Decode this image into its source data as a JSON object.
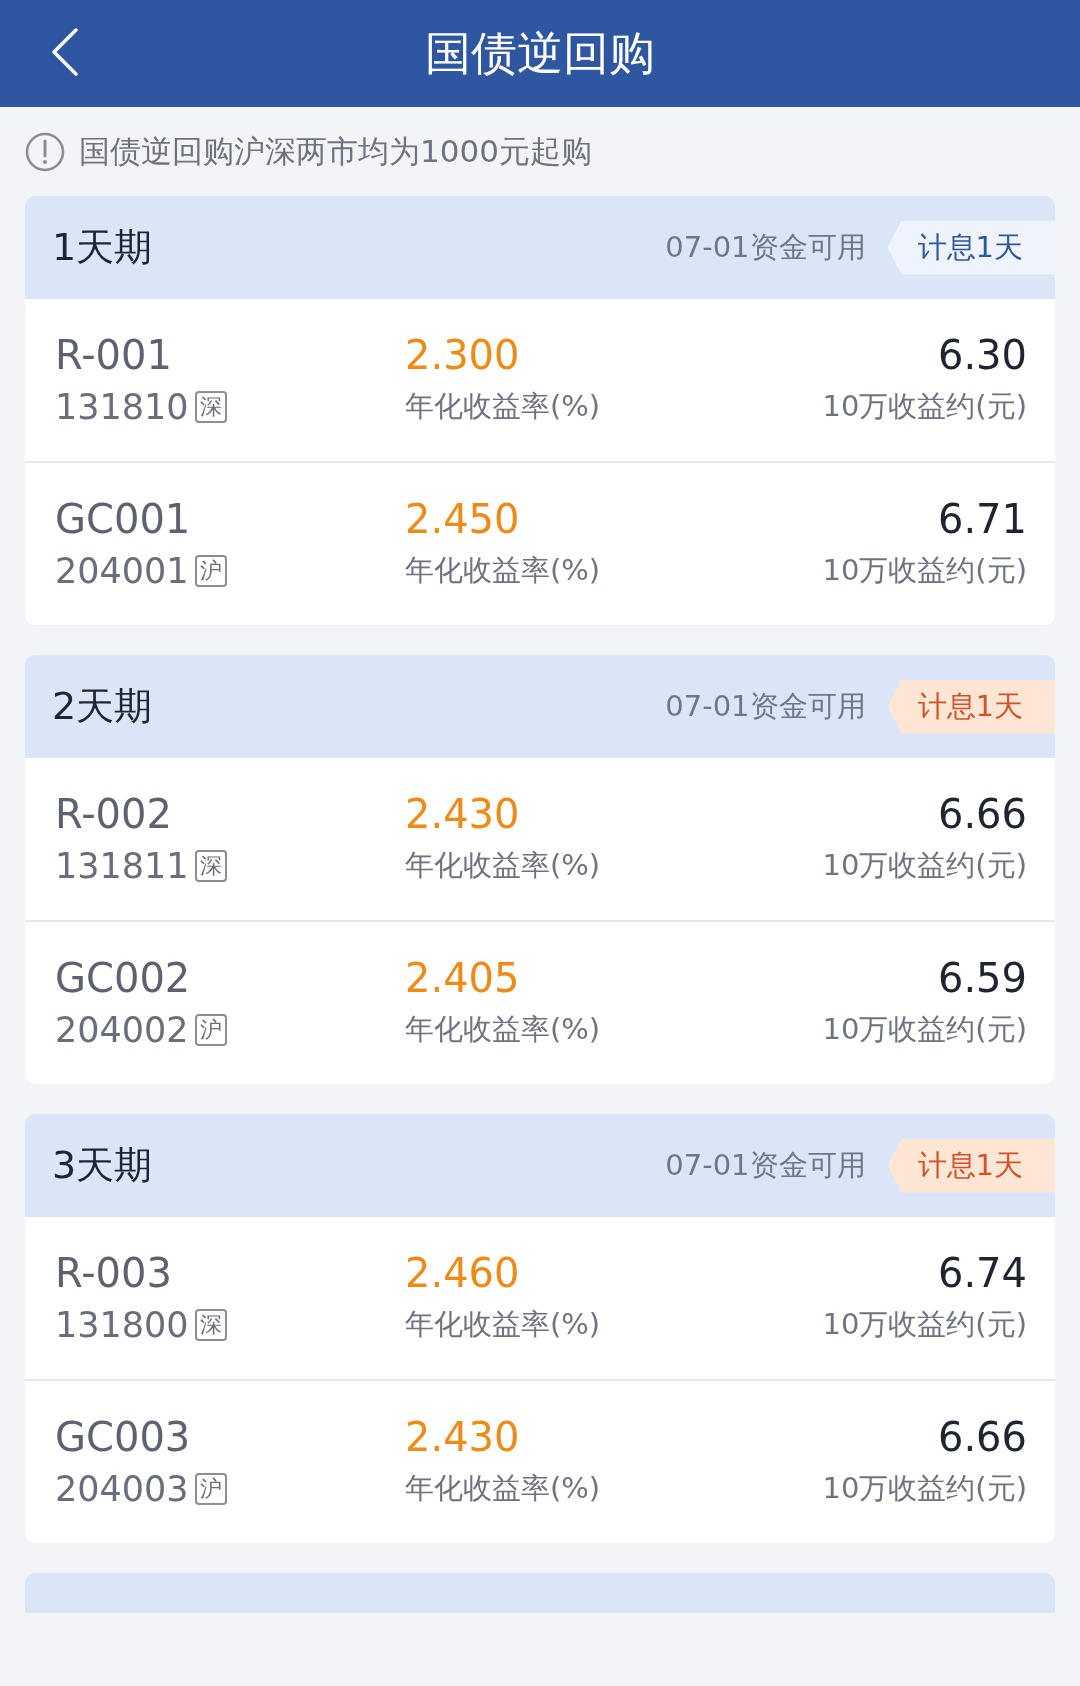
{
  "header": {
    "title": "国债逆回购"
  },
  "notice": "国债逆回购沪深两市均为1000元起购",
  "sections": [
    {
      "title": "1天期",
      "available": "07-01资金可用",
      "tag": {
        "label": "计息1天",
        "highlighted": false
      },
      "items": [
        {
          "name": "R-001",
          "code": "131810",
          "market": "深",
          "rate": "2.300",
          "rate_label": "年化收益率(%)",
          "earning": "6.30",
          "earning_label": "10万收益约(元)"
        },
        {
          "name": "GC001",
          "code": "204001",
          "market": "沪",
          "rate": "2.450",
          "rate_label": "年化收益率(%)",
          "earning": "6.71",
          "earning_label": "10万收益约(元)"
        }
      ]
    },
    {
      "title": "2天期",
      "available": "07-01资金可用",
      "tag": {
        "label": "计息1天",
        "highlighted": true
      },
      "items": [
        {
          "name": "R-002",
          "code": "131811",
          "market": "深",
          "rate": "2.430",
          "rate_label": "年化收益率(%)",
          "earning": "6.66",
          "earning_label": "10万收益约(元)"
        },
        {
          "name": "GC002",
          "code": "204002",
          "market": "沪",
          "rate": "2.405",
          "rate_label": "年化收益率(%)",
          "earning": "6.59",
          "earning_label": "10万收益约(元)"
        }
      ]
    },
    {
      "title": "3天期",
      "available": "07-01资金可用",
      "tag": {
        "label": "计息1天",
        "highlighted": true
      },
      "items": [
        {
          "name": "R-003",
          "code": "131800",
          "market": "深",
          "rate": "2.460",
          "rate_label": "年化收益率(%)",
          "earning": "6.74",
          "earning_label": "10万收益约(元)"
        },
        {
          "name": "GC003",
          "code": "204003",
          "market": "沪",
          "rate": "2.430",
          "rate_label": "年化收益率(%)",
          "earning": "6.66",
          "earning_label": "10万收益约(元)"
        }
      ]
    }
  ]
}
